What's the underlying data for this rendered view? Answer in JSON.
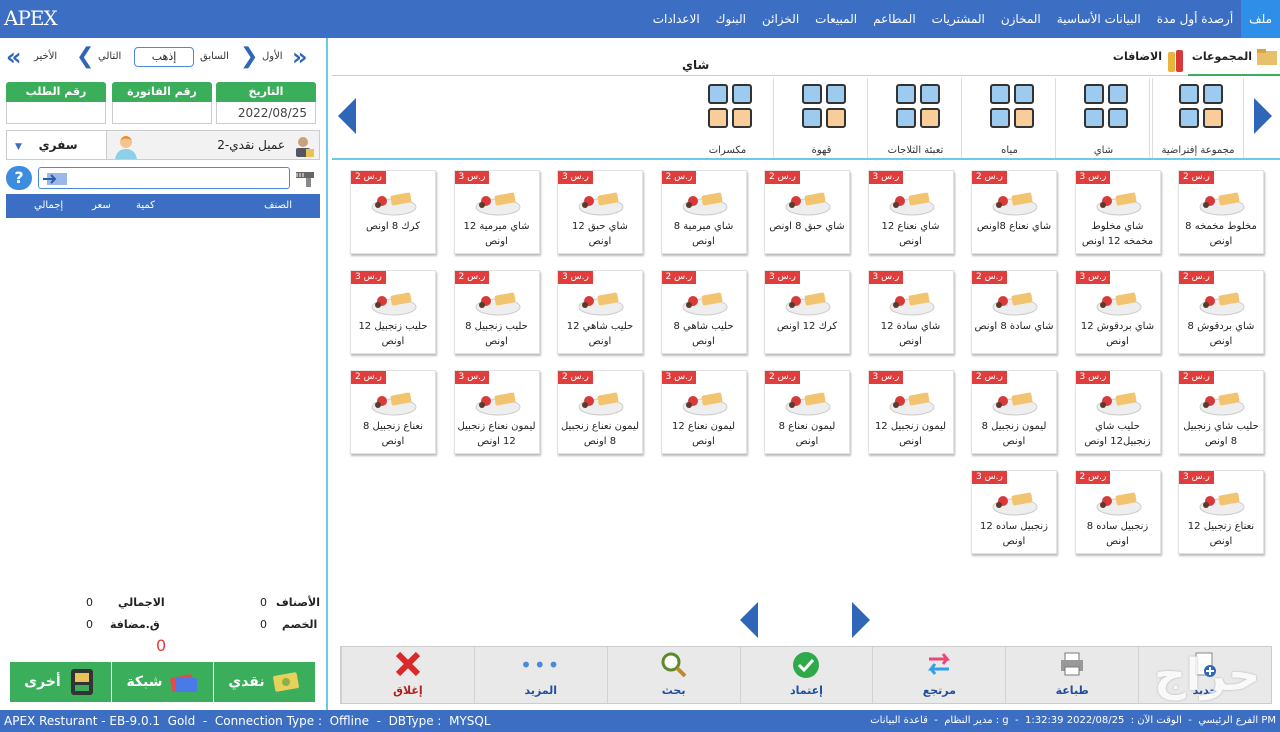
{
  "app": {
    "logo": "APEX"
  },
  "menu": [
    "ملف",
    "أرصدة أول مدة",
    "البيانات الأساسية",
    "المخازن",
    "المشتريات",
    "المطاعم",
    "المبيعات",
    "الخزائن",
    "البنوك",
    "الاعدادات"
  ],
  "left": {
    "nav": {
      "first": "الأول",
      "prev": "السابق",
      "go": "إذهب",
      "next": "التالي",
      "last": "الأخير"
    },
    "headers": {
      "date_label": "التاريخ",
      "date_value": "2022/08/25",
      "invoice_label": "رقم الفاتورة",
      "invoice_value": "",
      "order_label": "رقم الطلب",
      "order_value": ""
    },
    "customer": "2-عميل نقدي",
    "order_type": "سفري",
    "grid": {
      "item": "الصنف",
      "qty": "كمية",
      "price": "سعر",
      "total": "إجمالي"
    },
    "totals": {
      "items_label": "الأصناف",
      "items_value": "0",
      "total_label": "الاجمالي",
      "total_value": "0",
      "discount_label": "الخصم",
      "discount_value": "0",
      "added_label": "ق.مضافة",
      "added_value": "0",
      "grand": "0"
    },
    "pay": {
      "cash": "نقدي",
      "network": "شبكة",
      "other": "أخرى"
    }
  },
  "right": {
    "tabs": {
      "groups": "المجموعات",
      "additions": "الاضافات"
    },
    "category_title": "شاي",
    "categories": [
      "مجموعة إفتراضية",
      "شاي",
      "مياه",
      "تعبئة الثلاجات",
      "قهوة",
      "مكسرات"
    ],
    "products": [
      [
        {
          "n": "مخلوط مخمخه 8 اونص",
          "p": "2 ر.س"
        },
        {
          "n": "شاي مخلوط مخمخه 12 اونص",
          "p": "3 ر.س"
        },
        {
          "n": "شاي نعناع 8اونص",
          "p": "2 ر.س"
        },
        {
          "n": "شاي نعناع 12 اونص",
          "p": "3 ر.س"
        },
        {
          "n": "شاي حبق 8 اونص",
          "p": "2 ر.س"
        },
        {
          "n": "شاي ميرمية 8 اونص",
          "p": "2 ر.س"
        },
        {
          "n": "شاي حبق 12 اونص",
          "p": "3 ر.س"
        },
        {
          "n": "شاي ميرمية 12 اونص",
          "p": "3 ر.س"
        },
        {
          "n": "كرك 8 اونص",
          "p": "2 ر.س"
        }
      ],
      [
        {
          "n": "شاي بردقوش 8 اونص",
          "p": "2 ر.س"
        },
        {
          "n": "شاي بردقوش 12 اونص",
          "p": "3 ر.س"
        },
        {
          "n": "شاي سادة 8 اونص",
          "p": "2 ر.س"
        },
        {
          "n": "شاي سادة 12 اونص",
          "p": "3 ر.س"
        },
        {
          "n": "كرك 12 اونص",
          "p": "3 ر.س"
        },
        {
          "n": "حليب شاهي 8 اونص",
          "p": "2 ر.س"
        },
        {
          "n": "حليب شاهي 12 اونص",
          "p": "3 ر.س"
        },
        {
          "n": "حليب زنجبيل 8 اونص",
          "p": "2 ر.س"
        },
        {
          "n": "حليب زنجبيل 12 اونص",
          "p": "3 ر.س"
        }
      ],
      [
        {
          "n": "حليب شاي زنجبيل 8 اونص",
          "p": "2 ر.س"
        },
        {
          "n": "حليب شاي زنجبيل12 اونص",
          "p": "3 ر.س"
        },
        {
          "n": "ليمون زنجبيل 8 اونص",
          "p": "2 ر.س"
        },
        {
          "n": "ليمون زنجبيل 12 اونص",
          "p": "3 ر.س"
        },
        {
          "n": "ليمون نعناع 8 اونص",
          "p": "2 ر.س"
        },
        {
          "n": "ليمون نعناع 12 اونص",
          "p": "3 ر.س"
        },
        {
          "n": "ليمون نعناع زنجبيل 8 اونص",
          "p": "2 ر.س"
        },
        {
          "n": "ليمون نعناع زنجبيل 12 اونص",
          "p": "3 ر.س"
        },
        {
          "n": "نعناع زنجبيل 8 اونص",
          "p": "2 ر.س"
        }
      ],
      [
        {
          "n": "نعناع زنجبيل 12 اونص",
          "p": "3 ر.س"
        },
        {
          "n": "زنجبيل ساده 8 اونص",
          "p": "2 ر.س"
        },
        {
          "n": "زنجبيل ساده 12 اونص",
          "p": "3 ر.س"
        }
      ]
    ],
    "actions": [
      "جديد",
      "طباعة",
      "مرتجع",
      "إعتماد",
      "بحث",
      "المزيد",
      "إغلاق"
    ]
  },
  "status": {
    "left": "APEX Resturant - EB-9.0.1  Gold  -  Connection Type :  Offline  -  DBType :  MYSQL",
    "right": "مدير النظام  -  قاعدة البيانات : g  -  الفرع الرئيسي  -  الوقت الآن :  2022/08/25 1:32:39 PM"
  },
  "watermark": "حراج"
}
